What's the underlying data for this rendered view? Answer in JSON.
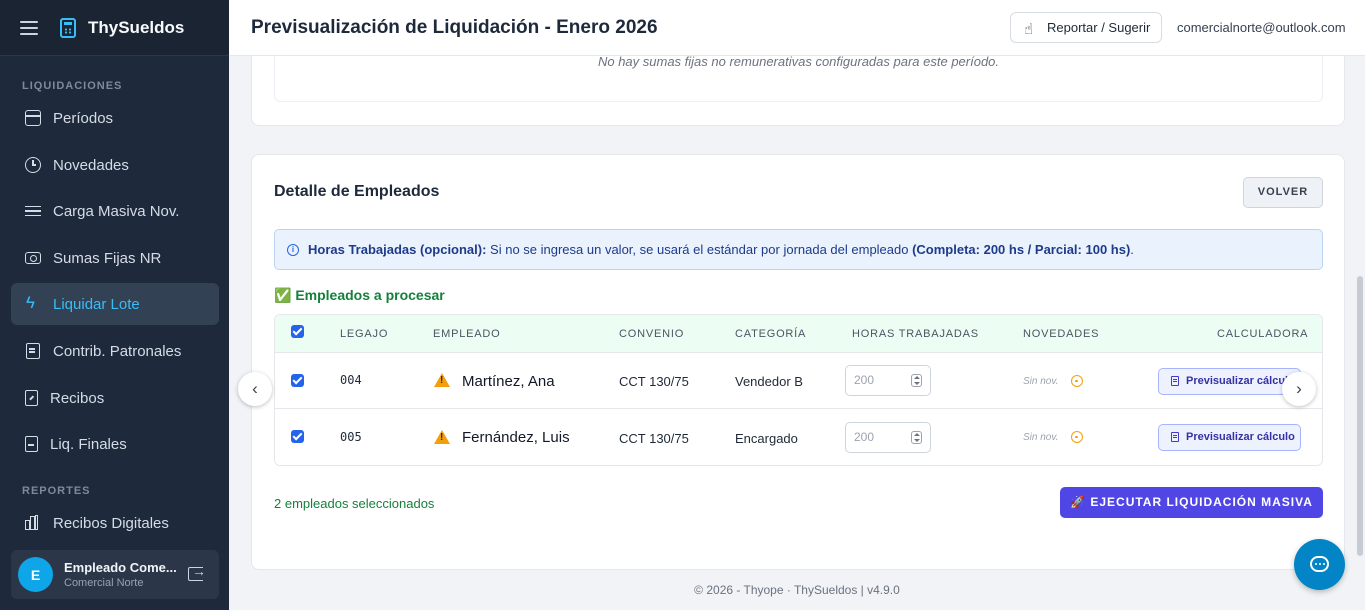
{
  "app": {
    "brand": "ThySueldos"
  },
  "sidebar": {
    "section_liq": "LIQUIDACIONES",
    "section_rep": "REPORTES",
    "items": [
      {
        "label": "Períodos",
        "icon": "calendar-icon"
      },
      {
        "label": "Novedades",
        "icon": "clock-icon"
      },
      {
        "label": "Carga Masiva Nov.",
        "icon": "table-icon"
      },
      {
        "label": "Sumas Fijas NR",
        "icon": "cash-icon"
      },
      {
        "label": "Liquidar Lote",
        "icon": "bolt-icon",
        "active": true
      },
      {
        "label": "Contrib. Patronales",
        "icon": "bank-icon"
      },
      {
        "label": "Recibos",
        "icon": "receipt-icon"
      },
      {
        "label": "Liq. Finales",
        "icon": "document-icon"
      },
      {
        "label": "Recibos Digitales",
        "icon": "bar-chart-icon"
      }
    ],
    "user": {
      "initial": "E",
      "name": "Empleado Come...",
      "org": "Comercial Norte"
    }
  },
  "header": {
    "title": "Previsualización de Liquidación - Enero 2026",
    "report_label": "Reportar / Sugerir",
    "email": "comercialnorte@outlook.com"
  },
  "top_card": {
    "empty_text": "No hay sumas fijas no remunerativas configuradas para este período."
  },
  "detail": {
    "title": "Detalle de Empleados",
    "back_label": "VOLVER",
    "info_bold": "Horas Trabajadas (opcional):",
    "info_text": " Si no se ingresa un valor, se usará el estándar por jornada del empleado ",
    "info_bold2": "(Completa: 200 hs / Parcial: 100 hs)",
    "info_end": ".",
    "process_title": "✅ Empleados a procesar",
    "columns": [
      "LEGAJO",
      "EMPLEADO",
      "CONVENIO",
      "CATEGORÍA",
      "HORAS TRABAJADAS",
      "NOVEDADES",
      "CALCULADORA"
    ],
    "rows": [
      {
        "legajo": "004",
        "empleado": "Martínez, Ana",
        "convenio": "CCT 130/75",
        "categoria": "Vendedor B",
        "horas_placeholder": "200",
        "novedades": "Sin nov.",
        "calc_label": "Previsualizar cálculo"
      },
      {
        "legajo": "005",
        "empleado": "Fernández, Luis",
        "convenio": "CCT 130/75",
        "categoria": "Encargado",
        "horas_placeholder": "200",
        "novedades": "Sin nov.",
        "calc_label": "Previsualizar cálculo"
      }
    ],
    "selected_text": "2 empleados seleccionados",
    "exec_label": "🚀 EJECUTAR LIQUIDACIÓN MASIVA"
  },
  "footer": {
    "text": "© 2026 - Thyope · ThySueldos | v4.9.0"
  },
  "colors": {
    "sidebar_bg": "#1e293b",
    "accent": "#38bdf8",
    "primary_button": "#4f46e5",
    "success": "#15803d"
  }
}
